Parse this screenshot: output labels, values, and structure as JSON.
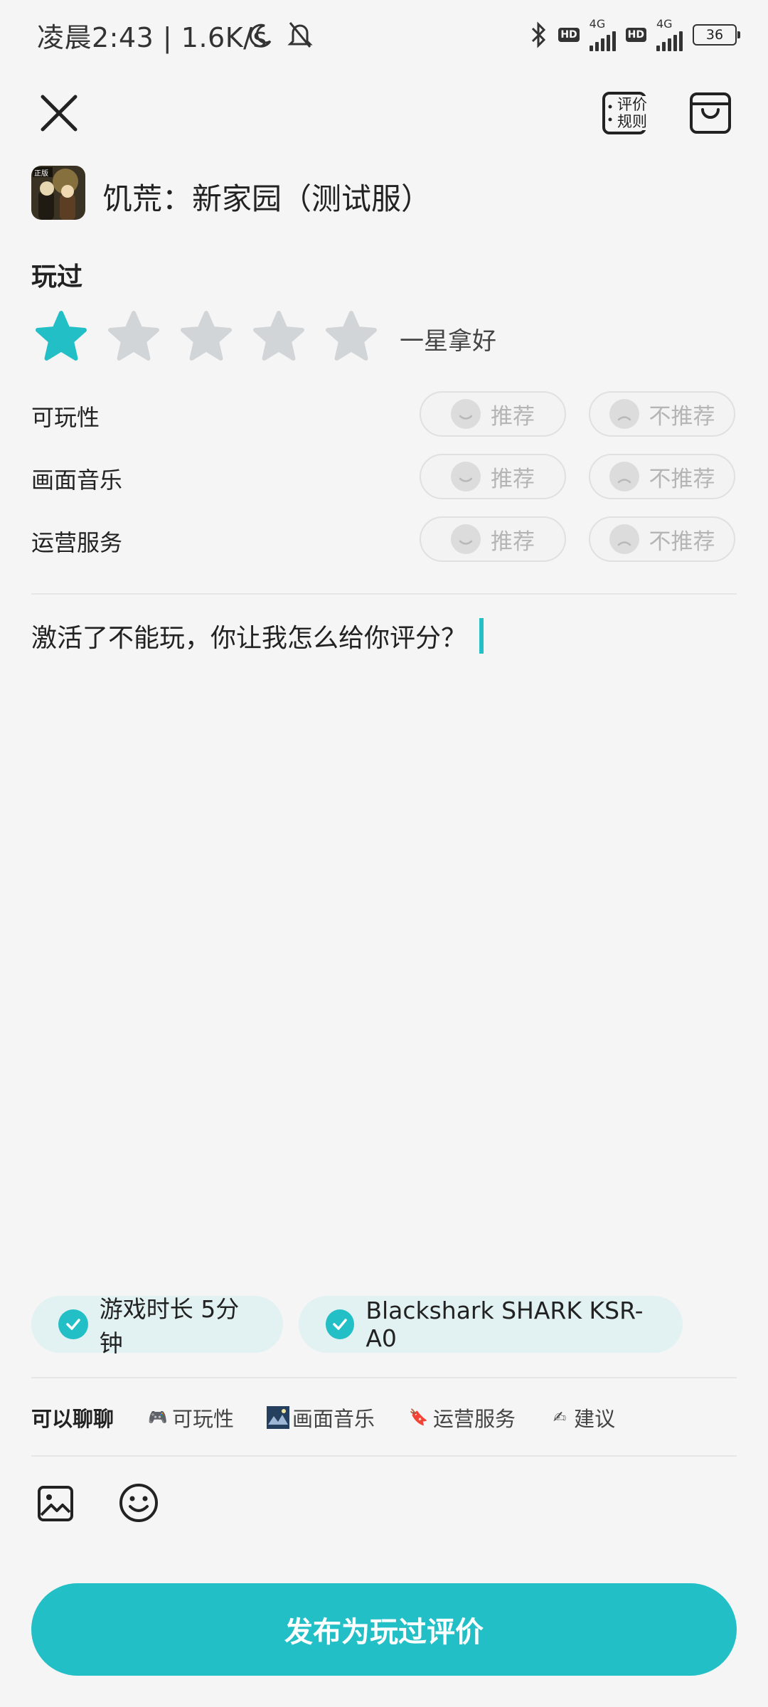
{
  "status_bar": {
    "time": "凌晨2:43 | 1.6K/s",
    "network_1": "4G",
    "network_2": "4G",
    "hd_1": "HD",
    "hd_2": "HD",
    "battery": "36"
  },
  "header": {
    "rules_line1": "评价",
    "rules_line2": "规则"
  },
  "game": {
    "title": "饥荒：新家园（测试服）",
    "icon_badge": "正版"
  },
  "rating": {
    "section_label": "玩过",
    "stars_total": 5,
    "stars_selected": 1,
    "text": "一星拿好",
    "active_color": "#22bfc6",
    "inactive_color": "#d2d5d7"
  },
  "categories": [
    {
      "label": "可玩性",
      "recommend": "推荐",
      "not_recommend": "不推荐"
    },
    {
      "label": "画面音乐",
      "recommend": "推荐",
      "not_recommend": "不推荐"
    },
    {
      "label": "运营服务",
      "recommend": "推荐",
      "not_recommend": "不推荐"
    }
  ],
  "review": {
    "text": "激活了不能玩，你让我怎么给你评分？"
  },
  "tags": [
    {
      "label": "游戏时长 5分钟"
    },
    {
      "label": "Blackshark SHARK KSR-A0"
    }
  ],
  "topics": {
    "lead": "可以聊聊",
    "items": [
      {
        "icon": "game-controller-icon",
        "label": "可玩性"
      },
      {
        "icon": "picture-icon",
        "label": "画面音乐"
      },
      {
        "icon": "bookmark-icon",
        "label": "运营服务"
      },
      {
        "icon": "writing-hand-icon",
        "label": "建议"
      }
    ]
  },
  "toolbar": {
    "image_icon": "image-icon",
    "emoji_icon": "smiley-icon"
  },
  "publish": {
    "label": "发布为玩过评价"
  },
  "colors": {
    "accent": "#22bfc6",
    "chip_bg": "#e2f1f1"
  }
}
